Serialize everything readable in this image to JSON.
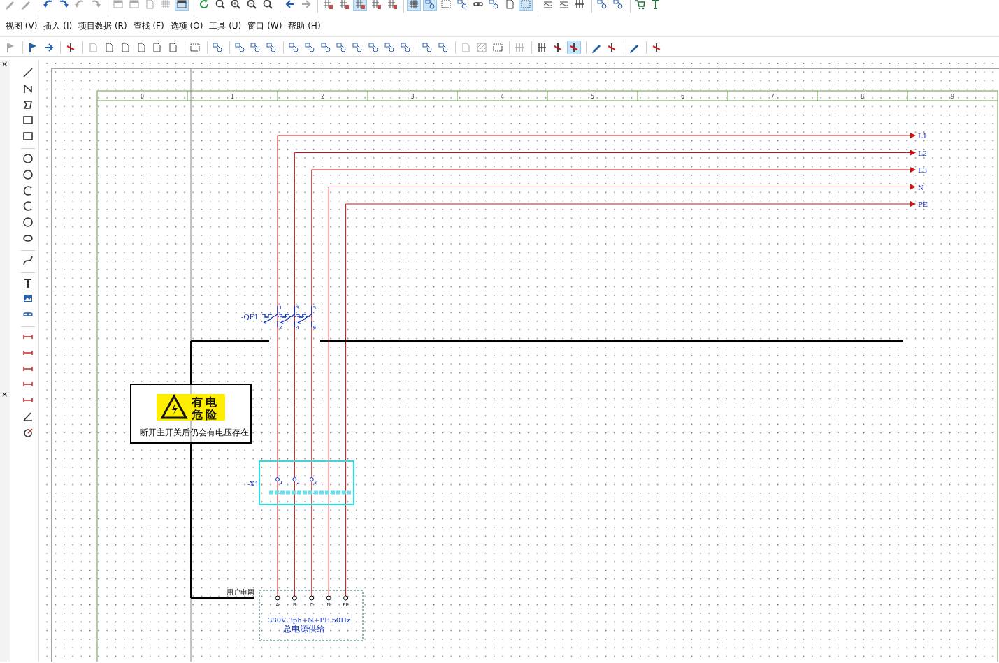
{
  "top_toolbar": [
    {
      "kind": "pencil",
      "selected": false,
      "disabled": true
    },
    {
      "kind": "pencil",
      "selected": false,
      "disabled": true
    },
    {
      "kind": "sep"
    },
    {
      "kind": "undo",
      "selected": false,
      "disabled": false
    },
    {
      "kind": "redo",
      "selected": false,
      "disabled": false
    },
    {
      "kind": "undo",
      "selected": false,
      "disabled": true
    },
    {
      "kind": "redo",
      "selected": false,
      "disabled": true
    },
    {
      "kind": "sep"
    },
    {
      "kind": "window",
      "selected": false,
      "disabled": true
    },
    {
      "kind": "window",
      "selected": false,
      "disabled": true
    },
    {
      "kind": "page",
      "selected": false,
      "disabled": true
    },
    {
      "kind": "grid",
      "selected": false,
      "disabled": true
    },
    {
      "kind": "window",
      "selected": true,
      "disabled": false
    },
    {
      "kind": "sep"
    },
    {
      "kind": "refresh",
      "selected": false,
      "disabled": false
    },
    {
      "kind": "zoom",
      "selected": false,
      "disabled": false
    },
    {
      "kind": "zoomin",
      "selected": false,
      "disabled": false
    },
    {
      "kind": "zoomout",
      "selected": false,
      "disabled": false
    },
    {
      "kind": "zoom",
      "selected": false,
      "disabled": false
    },
    {
      "kind": "sep"
    },
    {
      "kind": "left",
      "selected": false,
      "disabled": false
    },
    {
      "kind": "right",
      "selected": false,
      "disabled": true
    },
    {
      "kind": "sep"
    },
    {
      "kind": "hash",
      "selected": false,
      "disabled": false
    },
    {
      "kind": "hash",
      "selected": false,
      "disabled": false
    },
    {
      "kind": "hash",
      "selected": true,
      "disabled": false
    },
    {
      "kind": "hash",
      "selected": false,
      "disabled": false
    },
    {
      "kind": "hash",
      "selected": false,
      "disabled": false
    },
    {
      "kind": "sep"
    },
    {
      "kind": "grid",
      "selected": true,
      "disabled": false
    },
    {
      "kind": "node",
      "selected": true,
      "disabled": false
    },
    {
      "kind": "frame",
      "selected": false,
      "disabled": false
    },
    {
      "kind": "node",
      "selected": false,
      "disabled": false
    },
    {
      "kind": "link",
      "selected": false,
      "disabled": false
    },
    {
      "kind": "node",
      "selected": false,
      "disabled": false
    },
    {
      "kind": "page",
      "selected": false,
      "disabled": false
    },
    {
      "kind": "frame",
      "selected": true,
      "disabled": false
    },
    {
      "kind": "sep"
    },
    {
      "kind": "wave",
      "selected": false,
      "disabled": false
    },
    {
      "kind": "wave",
      "selected": false,
      "disabled": false
    },
    {
      "kind": "bars",
      "selected": false,
      "disabled": false
    },
    {
      "kind": "sep"
    },
    {
      "kind": "node",
      "selected": false,
      "disabled": false
    },
    {
      "kind": "node",
      "selected": false,
      "disabled": false
    },
    {
      "kind": "sep"
    },
    {
      "kind": "cart",
      "selected": false,
      "disabled": false
    },
    {
      "kind": "text",
      "selected": false,
      "disabled": false
    }
  ],
  "menu": [
    {
      "label": "视图 (V)"
    },
    {
      "label": "插入 (I)"
    },
    {
      "label": "项目数据 (R)"
    },
    {
      "label": "查找 (F)"
    },
    {
      "label": "选项 (O)"
    },
    {
      "label": "工具 (U)"
    },
    {
      "label": "窗口 (W)"
    },
    {
      "label": "帮助 (H)"
    }
  ],
  "toolbar": [
    {
      "kind": "flag",
      "selected": false,
      "disabled": true
    },
    {
      "kind": "sep"
    },
    {
      "kind": "flag",
      "selected": false,
      "disabled": false
    },
    {
      "kind": "right",
      "selected": false,
      "disabled": false
    },
    {
      "kind": "sep"
    },
    {
      "kind": "cross",
      "selected": false,
      "disabled": false
    },
    {
      "kind": "sep"
    },
    {
      "kind": "page",
      "selected": false,
      "disabled": true
    },
    {
      "kind": "page",
      "selected": false,
      "disabled": false
    },
    {
      "kind": "page",
      "selected": false,
      "disabled": false
    },
    {
      "kind": "page",
      "selected": false,
      "disabled": false
    },
    {
      "kind": "page",
      "selected": false,
      "disabled": false
    },
    {
      "kind": "page",
      "selected": false,
      "disabled": false
    },
    {
      "kind": "sep"
    },
    {
      "kind": "frame",
      "selected": false,
      "disabled": false
    },
    {
      "kind": "sep"
    },
    {
      "kind": "node",
      "selected": false,
      "disabled": false
    },
    {
      "kind": "sep"
    },
    {
      "kind": "node",
      "selected": false,
      "disabled": false
    },
    {
      "kind": "node",
      "selected": false,
      "disabled": false
    },
    {
      "kind": "node",
      "selected": false,
      "disabled": false
    },
    {
      "kind": "sep"
    },
    {
      "kind": "node",
      "selected": false,
      "disabled": false
    },
    {
      "kind": "node",
      "selected": false,
      "disabled": false
    },
    {
      "kind": "node",
      "selected": false,
      "disabled": false
    },
    {
      "kind": "node",
      "selected": false,
      "disabled": false
    },
    {
      "kind": "node",
      "selected": false,
      "disabled": false
    },
    {
      "kind": "node",
      "selected": false,
      "disabled": false
    },
    {
      "kind": "node",
      "selected": false,
      "disabled": false
    },
    {
      "kind": "node",
      "selected": false,
      "disabled": false
    },
    {
      "kind": "sep"
    },
    {
      "kind": "node",
      "selected": false,
      "disabled": false
    },
    {
      "kind": "node",
      "selected": false,
      "disabled": false
    },
    {
      "kind": "sep"
    },
    {
      "kind": "page",
      "selected": false,
      "disabled": true
    },
    {
      "kind": "hatch",
      "selected": false,
      "disabled": true
    },
    {
      "kind": "frame",
      "selected": false,
      "disabled": false
    },
    {
      "kind": "sep"
    },
    {
      "kind": "bars",
      "selected": false,
      "disabled": true
    },
    {
      "kind": "sep"
    },
    {
      "kind": "bars",
      "selected": false,
      "disabled": false
    },
    {
      "kind": "cross",
      "selected": false,
      "disabled": false
    },
    {
      "kind": "cross",
      "selected": true,
      "disabled": false
    },
    {
      "kind": "sep"
    },
    {
      "kind": "pencil",
      "selected": false,
      "disabled": false
    },
    {
      "kind": "cross",
      "selected": false,
      "disabled": false
    },
    {
      "kind": "sep"
    },
    {
      "kind": "pencil",
      "selected": false,
      "disabled": false
    },
    {
      "kind": "sep"
    },
    {
      "kind": "cross",
      "selected": false,
      "disabled": false
    }
  ],
  "side_panel": {
    "close_buttons": [
      "×",
      "×"
    ]
  },
  "draw_toolbar": [
    {
      "kind": "line"
    },
    {
      "kind": "polyline"
    },
    {
      "kind": "polygon"
    },
    {
      "kind": "rect"
    },
    {
      "kind": "rect"
    },
    {
      "kind": "sep"
    },
    {
      "kind": "circle"
    },
    {
      "kind": "circle"
    },
    {
      "kind": "arc"
    },
    {
      "kind": "arc"
    },
    {
      "kind": "circle"
    },
    {
      "kind": "ellipse"
    },
    {
      "kind": "sep"
    },
    {
      "kind": "curve"
    },
    {
      "kind": "sep"
    },
    {
      "kind": "text"
    },
    {
      "kind": "image"
    },
    {
      "kind": "link"
    },
    {
      "kind": "sep"
    },
    {
      "kind": "dim"
    },
    {
      "kind": "dim"
    },
    {
      "kind": "dim"
    },
    {
      "kind": "dim"
    },
    {
      "kind": "dim"
    },
    {
      "kind": "angle"
    },
    {
      "kind": "radius"
    }
  ],
  "canvas": {
    "ruler": [
      "0",
      "1",
      "2",
      "3",
      "4",
      "5",
      "6",
      "7",
      "8",
      "9"
    ],
    "busbars": [
      {
        "label": "L1"
      },
      {
        "label": "L2"
      },
      {
        "label": "L3"
      },
      {
        "label": "N"
      },
      {
        "label": "PE"
      }
    ],
    "breaker": {
      "tag": "-QF1",
      "top_pins": [
        "1",
        "3",
        "5"
      ],
      "bottom_pins": [
        "2",
        "4",
        "6"
      ]
    },
    "warning_sign": {
      "line1": "有 电",
      "line2": "危 险",
      "text": "断开主开关后仍会有电压存在"
    },
    "terminal_strip": {
      "tag": "-X1",
      "terminals": [
        "1",
        "2",
        "3"
      ]
    },
    "supply": {
      "caption": "用户电网",
      "terminals": [
        "A",
        "B",
        "C",
        "N",
        "PE"
      ],
      "spec": "380V 3ph+N+PE 50Hz",
      "name": "总电源供给"
    }
  }
}
